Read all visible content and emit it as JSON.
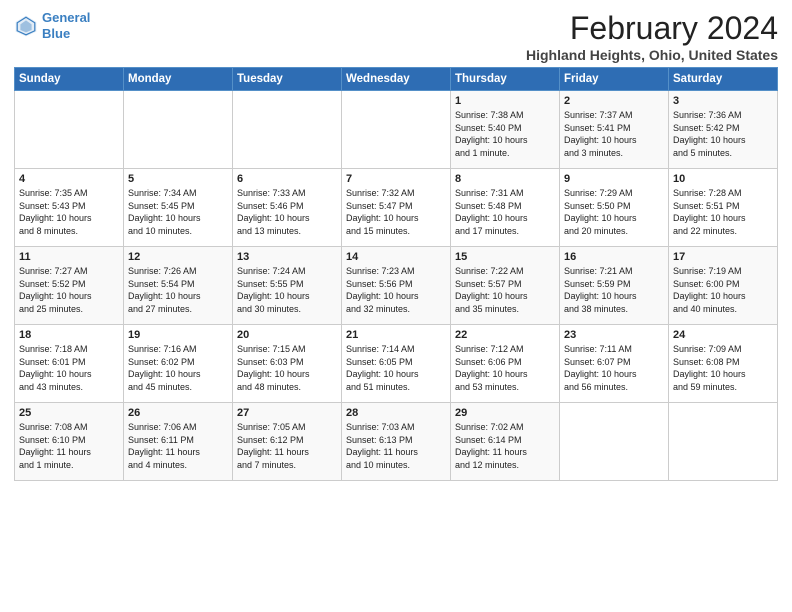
{
  "header": {
    "logo_line1": "General",
    "logo_line2": "Blue",
    "title": "February 2024",
    "subtitle": "Highland Heights, Ohio, United States"
  },
  "days_of_week": [
    "Sunday",
    "Monday",
    "Tuesday",
    "Wednesday",
    "Thursday",
    "Friday",
    "Saturday"
  ],
  "weeks": [
    [
      {
        "day": "",
        "info": ""
      },
      {
        "day": "",
        "info": ""
      },
      {
        "day": "",
        "info": ""
      },
      {
        "day": "",
        "info": ""
      },
      {
        "day": "1",
        "info": "Sunrise: 7:38 AM\nSunset: 5:40 PM\nDaylight: 10 hours\nand 1 minute."
      },
      {
        "day": "2",
        "info": "Sunrise: 7:37 AM\nSunset: 5:41 PM\nDaylight: 10 hours\nand 3 minutes."
      },
      {
        "day": "3",
        "info": "Sunrise: 7:36 AM\nSunset: 5:42 PM\nDaylight: 10 hours\nand 5 minutes."
      }
    ],
    [
      {
        "day": "4",
        "info": "Sunrise: 7:35 AM\nSunset: 5:43 PM\nDaylight: 10 hours\nand 8 minutes."
      },
      {
        "day": "5",
        "info": "Sunrise: 7:34 AM\nSunset: 5:45 PM\nDaylight: 10 hours\nand 10 minutes."
      },
      {
        "day": "6",
        "info": "Sunrise: 7:33 AM\nSunset: 5:46 PM\nDaylight: 10 hours\nand 13 minutes."
      },
      {
        "day": "7",
        "info": "Sunrise: 7:32 AM\nSunset: 5:47 PM\nDaylight: 10 hours\nand 15 minutes."
      },
      {
        "day": "8",
        "info": "Sunrise: 7:31 AM\nSunset: 5:48 PM\nDaylight: 10 hours\nand 17 minutes."
      },
      {
        "day": "9",
        "info": "Sunrise: 7:29 AM\nSunset: 5:50 PM\nDaylight: 10 hours\nand 20 minutes."
      },
      {
        "day": "10",
        "info": "Sunrise: 7:28 AM\nSunset: 5:51 PM\nDaylight: 10 hours\nand 22 minutes."
      }
    ],
    [
      {
        "day": "11",
        "info": "Sunrise: 7:27 AM\nSunset: 5:52 PM\nDaylight: 10 hours\nand 25 minutes."
      },
      {
        "day": "12",
        "info": "Sunrise: 7:26 AM\nSunset: 5:54 PM\nDaylight: 10 hours\nand 27 minutes."
      },
      {
        "day": "13",
        "info": "Sunrise: 7:24 AM\nSunset: 5:55 PM\nDaylight: 10 hours\nand 30 minutes."
      },
      {
        "day": "14",
        "info": "Sunrise: 7:23 AM\nSunset: 5:56 PM\nDaylight: 10 hours\nand 32 minutes."
      },
      {
        "day": "15",
        "info": "Sunrise: 7:22 AM\nSunset: 5:57 PM\nDaylight: 10 hours\nand 35 minutes."
      },
      {
        "day": "16",
        "info": "Sunrise: 7:21 AM\nSunset: 5:59 PM\nDaylight: 10 hours\nand 38 minutes."
      },
      {
        "day": "17",
        "info": "Sunrise: 7:19 AM\nSunset: 6:00 PM\nDaylight: 10 hours\nand 40 minutes."
      }
    ],
    [
      {
        "day": "18",
        "info": "Sunrise: 7:18 AM\nSunset: 6:01 PM\nDaylight: 10 hours\nand 43 minutes."
      },
      {
        "day": "19",
        "info": "Sunrise: 7:16 AM\nSunset: 6:02 PM\nDaylight: 10 hours\nand 45 minutes."
      },
      {
        "day": "20",
        "info": "Sunrise: 7:15 AM\nSunset: 6:03 PM\nDaylight: 10 hours\nand 48 minutes."
      },
      {
        "day": "21",
        "info": "Sunrise: 7:14 AM\nSunset: 6:05 PM\nDaylight: 10 hours\nand 51 minutes."
      },
      {
        "day": "22",
        "info": "Sunrise: 7:12 AM\nSunset: 6:06 PM\nDaylight: 10 hours\nand 53 minutes."
      },
      {
        "day": "23",
        "info": "Sunrise: 7:11 AM\nSunset: 6:07 PM\nDaylight: 10 hours\nand 56 minutes."
      },
      {
        "day": "24",
        "info": "Sunrise: 7:09 AM\nSunset: 6:08 PM\nDaylight: 10 hours\nand 59 minutes."
      }
    ],
    [
      {
        "day": "25",
        "info": "Sunrise: 7:08 AM\nSunset: 6:10 PM\nDaylight: 11 hours\nand 1 minute."
      },
      {
        "day": "26",
        "info": "Sunrise: 7:06 AM\nSunset: 6:11 PM\nDaylight: 11 hours\nand 4 minutes."
      },
      {
        "day": "27",
        "info": "Sunrise: 7:05 AM\nSunset: 6:12 PM\nDaylight: 11 hours\nand 7 minutes."
      },
      {
        "day": "28",
        "info": "Sunrise: 7:03 AM\nSunset: 6:13 PM\nDaylight: 11 hours\nand 10 minutes."
      },
      {
        "day": "29",
        "info": "Sunrise: 7:02 AM\nSunset: 6:14 PM\nDaylight: 11 hours\nand 12 minutes."
      },
      {
        "day": "",
        "info": ""
      },
      {
        "day": "",
        "info": ""
      }
    ]
  ]
}
